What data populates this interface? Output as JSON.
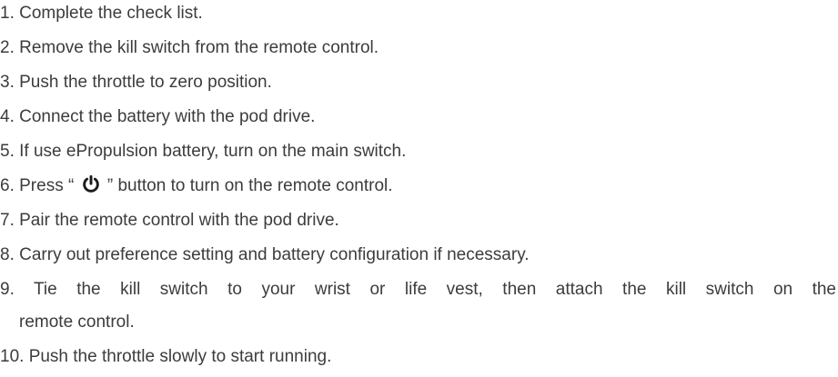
{
  "steps": [
    {
      "text": "1. Complete the check list."
    },
    {
      "text": "2. Remove the kill switch from the remote control."
    },
    {
      "text": "3. Push the throttle to zero position."
    },
    {
      "text": "4. Connect the battery with the pod drive."
    },
    {
      "text": "5. If use ePropulsion battery, turn on the main switch."
    },
    {
      "text_before": "6. Press “ ",
      "icon": "power-icon",
      "text_after": " ” button to turn on the remote control."
    },
    {
      "text": "7. Pair the remote control with the pod drive."
    },
    {
      "text": "8. Carry out preference setting and battery configuration if necessary."
    },
    {
      "line1": "9. Tie the kill switch to your wrist or life vest, then attach the kill switch on the",
      "line2": "remote control."
    },
    {
      "text": "10. Push the throttle slowly to start running."
    }
  ],
  "colors": {
    "text": "#3c3c3c",
    "background": "#ffffff"
  }
}
